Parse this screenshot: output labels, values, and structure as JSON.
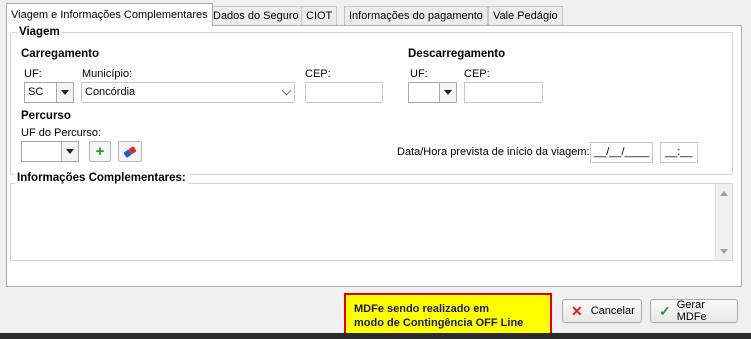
{
  "tabs": [
    {
      "label": "Viagem e Informações Complementares",
      "active": true
    },
    {
      "label": "Dados do Seguro"
    },
    {
      "label": "CIOT"
    },
    {
      "label": "Informações do pagamento"
    },
    {
      "label": "Vale Pedágio"
    }
  ],
  "viagem": {
    "title": "Viagem",
    "carregamento": {
      "title": "Carregamento",
      "uf_label": "UF:",
      "uf_value": "SC",
      "municipio_label": "Município:",
      "municipio_value": "Concórdia",
      "cep_label": "CEP:",
      "cep_value": ""
    },
    "descarregamento": {
      "title": "Descarregamento",
      "uf_label": "UF:",
      "uf_value": "",
      "cep_label": "CEP:",
      "cep_value": ""
    },
    "percurso": {
      "title": "Percurso",
      "uf_label": "UF do Percurso:",
      "uf_value": ""
    },
    "data_hora": {
      "label": "Data/Hora prevista de início da viagem:",
      "date_value": "__/__/____",
      "time_value": "__:__"
    }
  },
  "info_complementares": {
    "title": "Informações Complementares:",
    "value": ""
  },
  "alert": {
    "line1": "MDFe sendo realizado em",
    "line2": "modo de Contingência OFF Line",
    "bg_color": "#ffff00",
    "border_color": "#e00000"
  },
  "buttons": {
    "cancel_label": "Cancelar",
    "cancel_icon": "x-icon",
    "generate_label": "Gerar MDFe",
    "generate_icon": "check-icon"
  }
}
